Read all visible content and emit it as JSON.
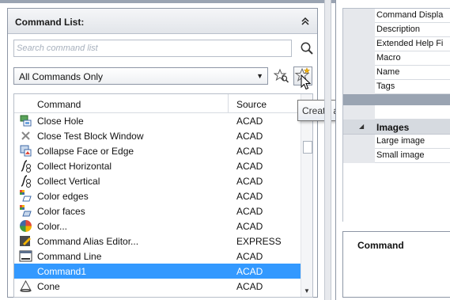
{
  "panel": {
    "title": "Command List:",
    "collapse_glyph": "»"
  },
  "search": {
    "placeholder": "Search command list"
  },
  "filter": {
    "selected": "All Commands Only"
  },
  "list": {
    "columns": [
      "Command",
      "Source"
    ],
    "rows": [
      {
        "icon": "close-hole-icon",
        "command": "Close Hole",
        "source": "ACAD"
      },
      {
        "icon": "close-test-block-icon",
        "command": "Close Test Block Window",
        "source": "ACAD"
      },
      {
        "icon": "collapse-face-icon",
        "command": "Collapse Face or Edge",
        "source": "ACAD"
      },
      {
        "icon": "collect-horizontal-icon",
        "command": "Collect Horizontal",
        "source": "ACAD"
      },
      {
        "icon": "collect-vertical-icon",
        "command": "Collect Vertical",
        "source": "ACAD"
      },
      {
        "icon": "color-edges-icon",
        "command": "Color edges",
        "source": "ACAD"
      },
      {
        "icon": "color-faces-icon",
        "command": "Color faces",
        "source": "ACAD"
      },
      {
        "icon": "color-wheel-icon",
        "command": "Color...",
        "source": "ACAD"
      },
      {
        "icon": "command-alias-editor-icon",
        "command": "Command Alias Editor...",
        "source": "EXPRESS"
      },
      {
        "icon": "command-line-icon",
        "command": "Command Line",
        "source": "ACAD"
      },
      {
        "icon": "",
        "command": "Command1",
        "source": "ACAD",
        "selected": true
      },
      {
        "icon": "cone-icon",
        "command": "Cone",
        "source": "ACAD"
      }
    ]
  },
  "tooltip": {
    "text": "Create a new command"
  },
  "properties": {
    "rows": [
      "Command Displa",
      "Description",
      "Extended Help Fi",
      "Macro",
      "Name",
      "Tags"
    ],
    "category": "Images",
    "image_rows": [
      "Large image",
      "Small image"
    ]
  },
  "command_box": {
    "label": "Command"
  },
  "colors": {
    "selection": "#3399ff",
    "category_bg": "#d6dae0"
  }
}
